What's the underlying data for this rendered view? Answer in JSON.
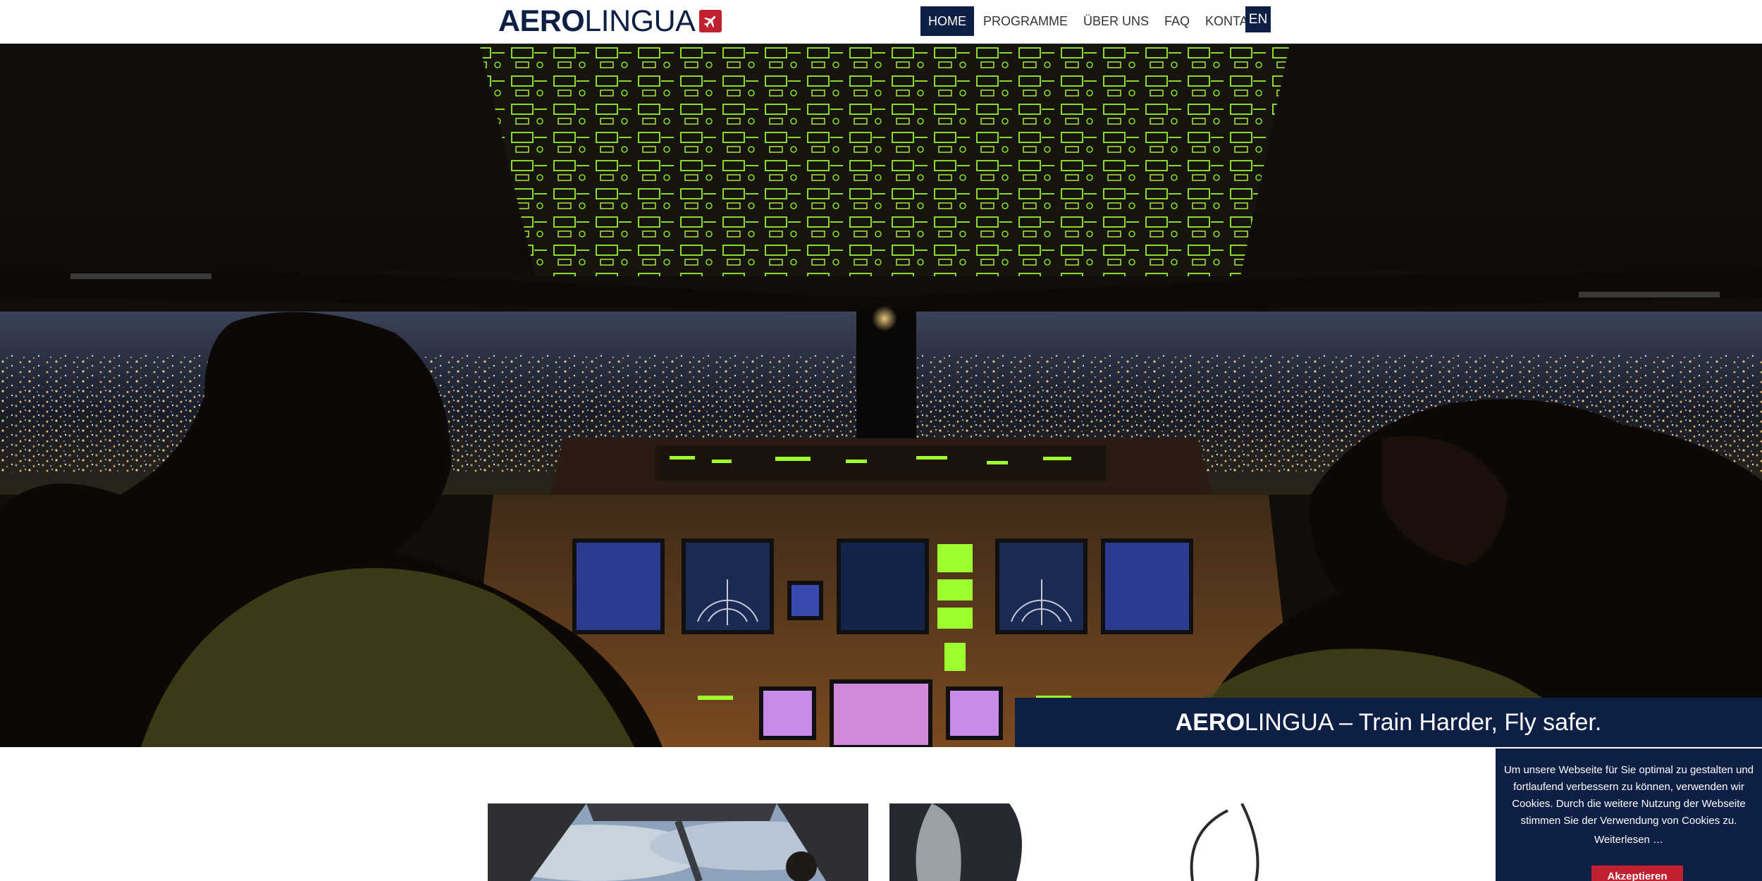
{
  "header": {
    "logo_bold": "AERO",
    "logo_light": "LINGUA",
    "logo_icon": "airplane-icon",
    "nav": [
      {
        "label": "HOME",
        "active": true
      },
      {
        "label": "PROGRAMME",
        "active": false
      },
      {
        "label": "ÜBER UNS",
        "active": false
      },
      {
        "label": "FAQ",
        "active": false
      },
      {
        "label": "KONTAKT",
        "active": false
      }
    ],
    "language": "EN"
  },
  "hero": {
    "caption_bold": "AERO",
    "caption_rest": "LINGUA – Train Harder, Fly safer."
  },
  "cookie": {
    "text": "Um unsere Webseite für Sie optimal zu gestalten und fortlaufend verbessern zu können, verwenden wir Cookies. Durch die weitere Nutzung der Webseite stimmen Sie der Verwendung von Cookies zu.",
    "read_more": "Weiterlesen …",
    "accept": "Akzeptieren"
  },
  "colors": {
    "brand_navy": "#0e1f45",
    "brand_red": "#c0212f",
    "panel_green": "#9dff2e"
  }
}
